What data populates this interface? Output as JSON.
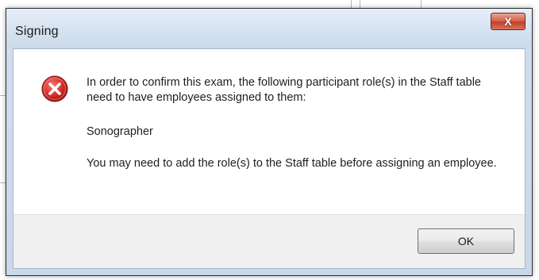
{
  "dialog": {
    "title": "Signing",
    "close_glyph": "X",
    "icon": "error-icon",
    "message": {
      "line_1": "In order to confirm this exam, the following participant role(s) in the Staff table need to have employees assigned to them:",
      "role": "Sonographer",
      "line_3": "You may need to add the role(s) to the Staff table before assigning an employee."
    },
    "ok_label": "OK"
  },
  "colors": {
    "error_red": "#d21f1f",
    "close_red": "#c2402a",
    "frame_blue": "#cfdcec"
  }
}
